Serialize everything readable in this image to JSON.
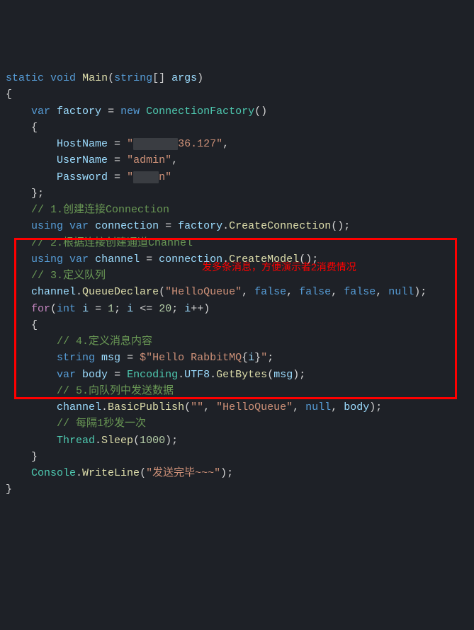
{
  "code": {
    "sig_static": "static",
    "sig_void": "void",
    "sig_main": "Main",
    "sig_string": "string",
    "sig_args": "args",
    "var_kw": "var",
    "factory": "factory",
    "new_kw": "new",
    "ConnectionFactory": "ConnectionFactory",
    "HostName": "HostName",
    "host_val_pre": "\"",
    "host_censor": "XXXXXXX",
    "host_val_post": "36.127\"",
    "UserName": "UserName",
    "user_val": "\"admin\"",
    "Password": "Password",
    "pass_val_pre": "\"",
    "pass_censor": "XXXX",
    "pass_val_post": "n\"",
    "c1": "// 1.创建连接Connection",
    "using_kw": "using",
    "connection": "connection",
    "CreateConnection": "CreateConnection",
    "c2": "// 2.根据连接创建通道Channel",
    "channel": "channel",
    "CreateModel": "CreateModel",
    "c3": "// 3.定义队列",
    "QueueDeclare": "QueueDeclare",
    "helloQueue": "\"HelloQueue\"",
    "false_kw": "false",
    "null_kw": "null",
    "for_kw": "for",
    "int_kw": "int",
    "i": "i",
    "one": "1",
    "twenty": "20",
    "c4": "// 4.定义消息内容",
    "string_kw": "string",
    "msg": "msg",
    "msg_str_pre": "$\"Hello RabbitMQ",
    "msg_str_interp_open": "{",
    "msg_str_interp_close": "}",
    "msg_str_post": "\"",
    "body": "body",
    "Encoding": "Encoding",
    "UTF8": "UTF8",
    "GetBytes": "GetBytes",
    "c5": "// 5.向队列中发送数据",
    "BasicPublish": "BasicPublish",
    "empty_str": "\"\"",
    "c6": "// 每隔1秒发一次",
    "Thread": "Thread",
    "Sleep": "Sleep",
    "thousand": "1000",
    "Console": "Console",
    "WriteLine": "WriteLine",
    "done_str": "\"发送完毕~~~\""
  },
  "annotation": "发多条消息，方便演示者2消费情况"
}
